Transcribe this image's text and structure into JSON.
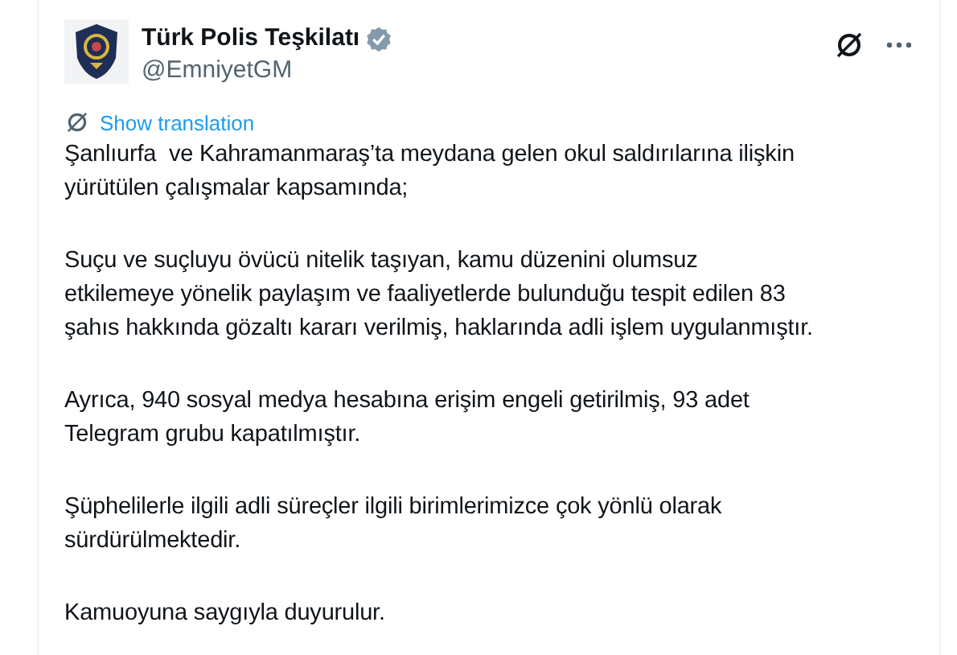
{
  "author": {
    "name": "Türk Polis Teşkilatı",
    "verified": true,
    "handle": "@EmniyetGM"
  },
  "translate_link": "Show translation",
  "paragraphs": [
    "Şanlıurfa  ve Kahramanmaraş’ta meydana gelen okul saldırılarına ilişkin\nyürütülen çalışmalar kapsamında;",
    "Suçu ve suçluyu övücü nitelik taşıyan, kamu düzenini olumsuz\netkilemeye yönelik paylaşım ve faaliyetlerde bulunduğu tespit edilen 83\nşahıs hakkında gözaltı kararı verilmiş, haklarında adli işlem uygulanmıştır.",
    "Ayrıca, 940 sosyal medya hesabına erişim engeli getirilmiş, 93 adet\nTelegram grubu kapatılmıştır.",
    "Şüphelilerle ilgili adli süreçler ilgili birimlerimizce çok yönlü olarak\nsürdürülmektedir.",
    "Kamuoyuna saygıyla duyurulur."
  ]
}
